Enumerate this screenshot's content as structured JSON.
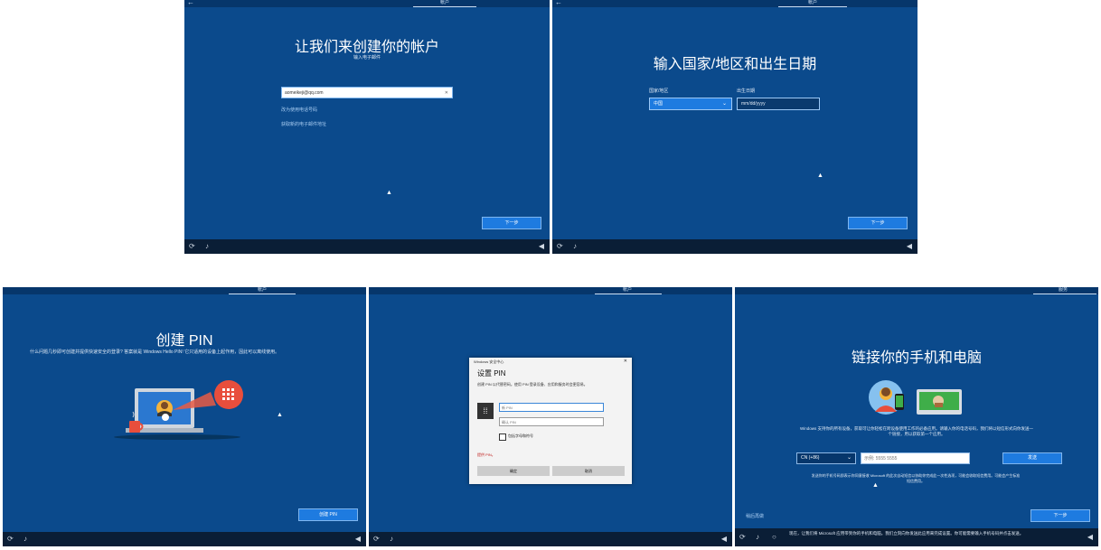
{
  "panel1": {
    "topbar_title": "帐户",
    "back_glyph": "←",
    "title": "让我们来创建你的帐户",
    "subtitle": "输入电子邮件",
    "email_value": "aomeikeji@qq.com",
    "clear_glyph": "✕",
    "link_phone": "改为使用电话号码",
    "link_new_email": "获取新的电子邮件地址",
    "next_label": "下一步"
  },
  "panel2": {
    "topbar_title": "帐户",
    "back_glyph": "←",
    "title": "输入国家/地区和出生日期",
    "country_label": "国家/地区",
    "country_value": "中国",
    "dob_label": "出生日期",
    "dob_placeholder": "mm/dd/yyyy",
    "next_label": "下一步"
  },
  "panel3": {
    "topbar_title": "帐户",
    "title": "创建 PIN",
    "description": "什么问题几秒即可创建并提供快速安全的登录? 答案就是 Windows Hello PIN! 它只适用的设备上起作用，因此可以离线使用。",
    "create_pin_label": "创建 PIN"
  },
  "panel4": {
    "topbar_title": "帐户",
    "dialog_app": "Windows 安全中心",
    "dialog_close": "✕",
    "dialog_title": "设置 PIN",
    "dialog_desc": "创建 PIN 以代替密码。使用 PIN 登录设备、应用和服务时会更容易。",
    "new_pin_placeholder": "新 PIN",
    "confirm_pin_placeholder": "确认 PIN",
    "checkbox_label": "包括字母和符号",
    "error_text": "提供 PIN。",
    "ok_label": "确定",
    "cancel_label": "取消"
  },
  "panel5": {
    "topbar_title": "服务",
    "title": "链接你的手机和电脑",
    "description": "Windows 支持你的所有设备，获取可让你轻松在跨设备使用工作的必备应用。请输入你的电话号码，我们将以短信形式向你发送一个链接，用以获取第一个应用。",
    "country_code": "CN (+86)",
    "phone_placeholder": "示例: 5555 5555",
    "send_label": "发送",
    "fineprint": "发送你的手机号码即表示你同意接收 Microsoft 的此次自动短信以协助你完成此一次性选项，可能会收取短信费用。可能会产生标准短信费用。",
    "later_label": "稍后再做",
    "next_label": "下一步",
    "notice": "现在，让我们将 Microsoft 应用带到你的手机和电脑。我们立刻向你发送此应用来完成设置。你可能需要输入手机号码并点击发送。"
  },
  "colors": {
    "oobe_blue": "#0b4a8c",
    "button_blue": "#1e7be0",
    "taskbar": "#0a1e36"
  }
}
